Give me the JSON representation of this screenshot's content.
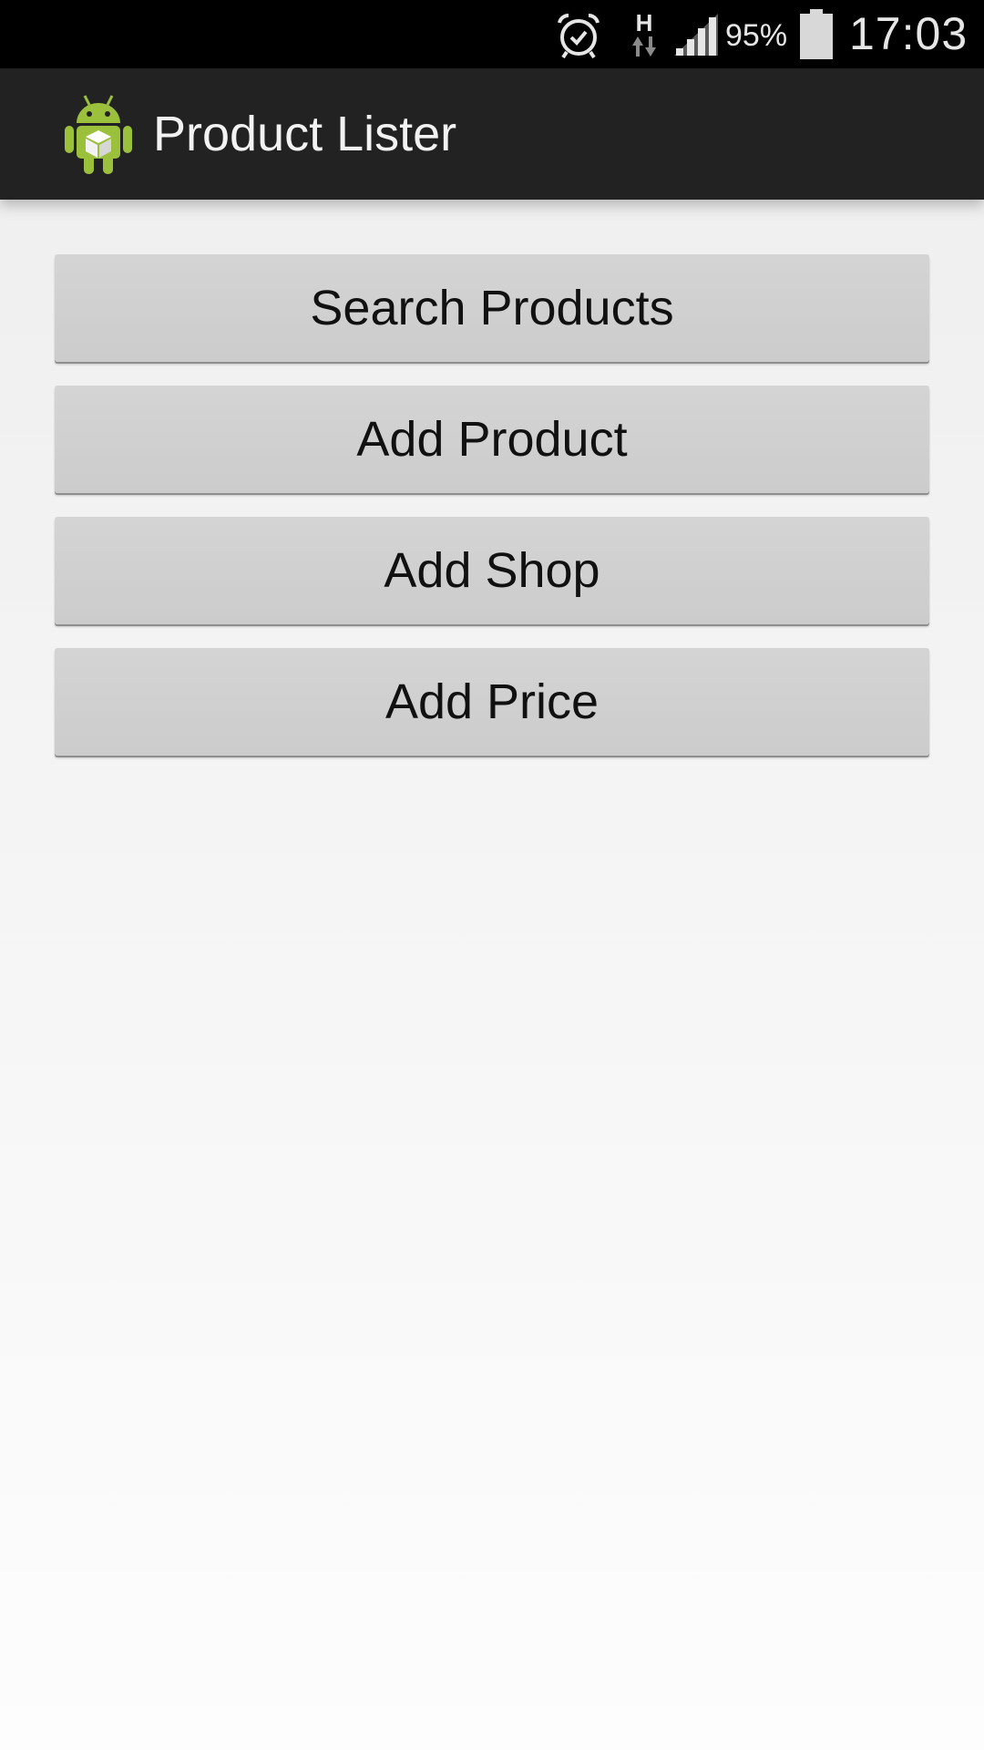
{
  "status_bar": {
    "icons": [
      "alarm-icon",
      "network-h-icon",
      "signal-icon",
      "battery-icon"
    ],
    "network_type": "H",
    "battery_percent": "95%",
    "time": "17:03"
  },
  "action_bar": {
    "app_icon": "android-box-icon",
    "title": "Product Lister"
  },
  "main": {
    "buttons": [
      {
        "label": "Search Products"
      },
      {
        "label": "Add Product"
      },
      {
        "label": "Add Shop"
      },
      {
        "label": "Add Price"
      }
    ]
  },
  "colors": {
    "status_bar_bg": "#000000",
    "action_bar_bg": "#222222",
    "button_bg": "#cccccc",
    "android_green": "#9bc13c"
  }
}
